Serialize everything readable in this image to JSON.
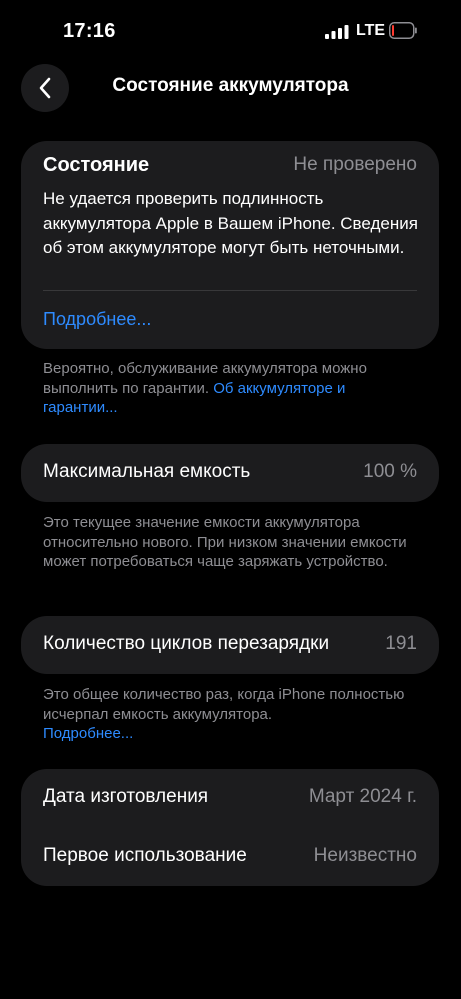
{
  "status_bar": {
    "time": "17:16",
    "network": "LTE",
    "battery_level": 0.1,
    "battery_color": "#ff3b30"
  },
  "nav": {
    "title": "Состояние аккумулятора",
    "back_icon": "chevron-left-icon"
  },
  "state_card": {
    "title": "Состояние",
    "value": "Не проверено",
    "body": "Не удается проверить подлинность аккумулятора Apple в Вашем iPhone. Сведения об этом аккумуляторе могут быть неточными.",
    "link": "Подробнее..."
  },
  "warranty_note": {
    "text": "Вероятно, обслуживание аккумулятора можно выполнить по гарантии. ",
    "link": "Об аккумуляторе и гарантии..."
  },
  "capacity": {
    "label": "Максимальная емкость",
    "value": "100 %",
    "note": "Это текущее значение емкости аккумулятора относительно нового. При низком значении емкости может потребоваться чаще заряжать устройство."
  },
  "cycles": {
    "label": "Количество циклов перезарядки",
    "value": "191",
    "note": "Это общее количество раз, когда iPhone полностью исчерпал емкость аккумулятора.",
    "link": "Подробнее..."
  },
  "dates": {
    "manufactured_label": "Дата изготовления",
    "manufactured_value": "Март 2024 г.",
    "first_use_label": "Первое использование",
    "first_use_value": "Неизвестно"
  },
  "colors": {
    "background": "#000000",
    "card": "#1c1c1e",
    "secondary_text": "#8e8e93",
    "link": "#2e8bff"
  }
}
